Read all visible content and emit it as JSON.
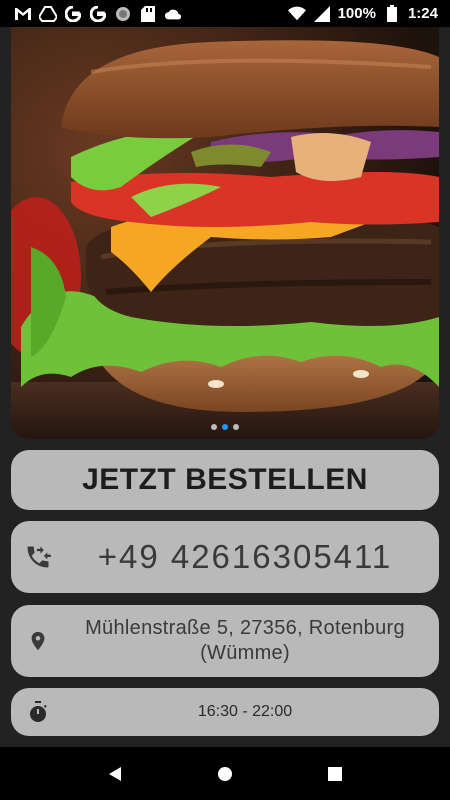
{
  "status_bar": {
    "battery": "100%",
    "time": "1:24",
    "left_icons": [
      "gmail-icon",
      "drive-icon",
      "google-icon",
      "google-icon",
      "circle-app-icon",
      "sd-card-icon",
      "cloud-icon"
    ],
    "right_icons": [
      "wifi-icon",
      "signal-icon",
      "battery-icon"
    ]
  },
  "hero": {
    "image": "burger-photo",
    "carousel_dots": 3,
    "active_dot": 1
  },
  "order": {
    "label": "JETZT BESTELLEN"
  },
  "phone": {
    "icon": "phone-forward-icon",
    "number": "+49 42616305411"
  },
  "address": {
    "icon": "location-pin-icon",
    "line1": "Mühlenstraße 5, 27356, Rotenburg",
    "line2": "(Wümme)"
  },
  "hours": {
    "icon": "timer-icon",
    "text": "16:30 - 22:00"
  },
  "nav_bar": {
    "buttons": [
      "back-icon",
      "home-icon",
      "recents-icon"
    ]
  },
  "colors": {
    "background": "#222222",
    "card": "#b9b9b9",
    "active_dot": "#2196f3"
  }
}
